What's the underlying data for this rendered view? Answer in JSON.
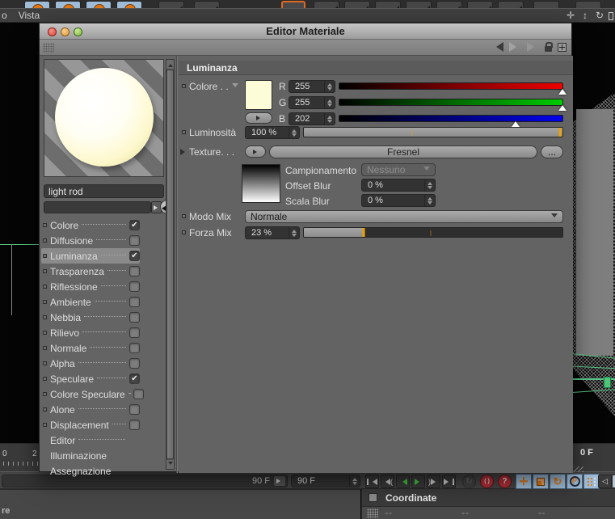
{
  "menu_bar": {
    "partial": "o",
    "vista": "Vista"
  },
  "window": {
    "title": "Editor Materiale",
    "material_name": "light rod",
    "channels": [
      {
        "label": "Colore",
        "check": "✔"
      },
      {
        "label": "Diffusione",
        "check": ""
      },
      {
        "label": "Luminanza",
        "check": "✔"
      },
      {
        "label": "Trasparenza",
        "check": ""
      },
      {
        "label": "Riflessione",
        "check": ""
      },
      {
        "label": "Ambiente",
        "check": ""
      },
      {
        "label": "Nebbia",
        "check": ""
      },
      {
        "label": "Rilievo",
        "check": ""
      },
      {
        "label": "Normale",
        "check": ""
      },
      {
        "label": "Alpha",
        "check": ""
      },
      {
        "label": "Speculare",
        "check": "✔"
      },
      {
        "label": "Colore Speculare",
        "check": ""
      },
      {
        "label": "Alone",
        "check": ""
      },
      {
        "label": "Displacement",
        "check": ""
      },
      {
        "label": "Editor",
        "check": ""
      },
      {
        "label": "Illuminazione",
        "check": ""
      },
      {
        "label": "Assegnazione",
        "check": ""
      }
    ],
    "section": {
      "title": "Luminanza",
      "color": {
        "label": "Colore . .",
        "r_label": "R",
        "g_label": "G",
        "b_label": "B",
        "r": "255",
        "g": "255",
        "b": "202",
        "r_pct": 100,
        "g_pct": 100,
        "b_pct": 79,
        "swatch": "#FDFCD8"
      },
      "brightness": {
        "label": "Luminosità",
        "value": "100 %",
        "fill_pct": 100,
        "marker_pct": 99,
        "tick_pct": 42
      },
      "texture": {
        "label": "Texture. . .",
        "value": "Fresnel",
        "more_label": "...",
        "sampling_label": "Campionamento",
        "sampling_value": "Nessuno",
        "offset_blur_label": "Offset Blur",
        "offset_blur_value": "0 %",
        "scale_blur_label": "Scala Blur",
        "scale_blur_value": "0 %"
      },
      "mix_mode": {
        "label": "Modo Mix",
        "value": "Normale"
      },
      "mix_strength": {
        "label": "Forza Mix",
        "value": "23 %",
        "fill_pct": 23,
        "marker_pct": 23,
        "tick_pct": 49
      }
    }
  },
  "timeline": {
    "ruler_marks": [
      "0",
      "2"
    ],
    "ruler_right": "0 F",
    "end_frame": "90 F",
    "current_frame": "90 F"
  },
  "coordinate_panel": {
    "title": "Coordinate",
    "values": [
      "--",
      "--",
      "--"
    ]
  },
  "bottom_left_partial": "re",
  "transport_help": "?",
  "transport_record": "( )",
  "icons": {
    "pan-icon": "✛",
    "zoom-icon": "↕",
    "rotate-view-icon": "↻",
    "move-tool-icon": "✛",
    "rotate-tool-icon": "↻",
    "axis-lock-icon": "P"
  },
  "colors": {
    "accent_orange": "#F0A000",
    "tool_orange": "#E07818",
    "play_green": "#44C544",
    "record_red": "#B03038",
    "highlight_blue": "#9FBDD8",
    "swatch_yellow": "#FDFCD8"
  }
}
